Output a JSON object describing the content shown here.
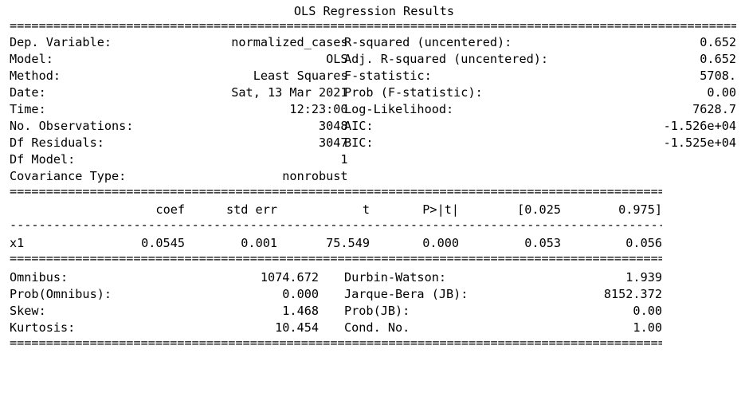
{
  "title": "OLS Regression Results",
  "summary": {
    "left": [
      {
        "label": "Dep. Variable:",
        "value": "normalized_cases"
      },
      {
        "label": "Model:",
        "value": "OLS"
      },
      {
        "label": "Method:",
        "value": "Least Squares"
      },
      {
        "label": "Date:",
        "value": "Sat, 13 Mar 2021"
      },
      {
        "label": "Time:",
        "value": "12:23:00"
      },
      {
        "label": "No. Observations:",
        "value": "3048"
      },
      {
        "label": "Df Residuals:",
        "value": "3047"
      },
      {
        "label": "Df Model:",
        "value": "1"
      },
      {
        "label": "Covariance Type:",
        "value": "nonrobust"
      }
    ],
    "right": [
      {
        "label": "R-squared (uncentered):",
        "value": "0.652"
      },
      {
        "label": "Adj. R-squared (uncentered):",
        "value": "0.652"
      },
      {
        "label": "F-statistic:",
        "value": "5708."
      },
      {
        "label": "Prob (F-statistic):",
        "value": "0.00"
      },
      {
        "label": "Log-Likelihood:",
        "value": "7628.7"
      },
      {
        "label": "AIC:",
        "value": "-1.526e+04"
      },
      {
        "label": "BIC:",
        "value": "-1.525e+04"
      }
    ]
  },
  "coef_table": {
    "headers": [
      "coef",
      "std err",
      "t",
      "P>|t|",
      "[0.025",
      "0.975]"
    ],
    "rows": [
      {
        "name": "x1",
        "values": [
          "0.0545",
          "0.001",
          "75.549",
          "0.000",
          "0.053",
          "0.056"
        ]
      }
    ]
  },
  "diagnostics": {
    "left": [
      {
        "label": "Omnibus:",
        "value": "1074.672"
      },
      {
        "label": "Prob(Omnibus):",
        "value": "0.000"
      },
      {
        "label": "Skew:",
        "value": "1.468"
      },
      {
        "label": "Kurtosis:",
        "value": "10.454"
      }
    ],
    "right": [
      {
        "label": "Durbin-Watson:",
        "value": "1.939"
      },
      {
        "label": "Jarque-Bera (JB):",
        "value": "8152.372"
      },
      {
        "label": "Prob(JB):",
        "value": "0.00"
      },
      {
        "label": "Cond. No.",
        "value": "1.00"
      }
    ]
  }
}
